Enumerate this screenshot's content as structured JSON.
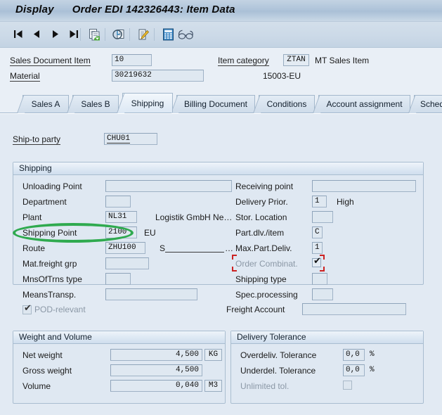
{
  "window": {
    "title_action": "Display",
    "title_object": "Order EDI 142326443: Item Data"
  },
  "toolbar": {
    "buttons": [
      {
        "name": "first-record-button",
        "icon": "first-record-icon",
        "glyph": "◀|",
        "label": "First record"
      },
      {
        "name": "previous-record-button",
        "icon": "previous-record-icon",
        "glyph": "◀",
        "label": "Previous record"
      },
      {
        "name": "next-record-button",
        "icon": "next-record-icon",
        "glyph": "▶",
        "label": "Next record"
      },
      {
        "name": "last-record-button",
        "icon": "last-record-icon",
        "glyph": "|▶",
        "label": "Last record"
      },
      {
        "name": "copy-items-button",
        "icon": "copy-documents-icon",
        "glyph": "",
        "label": "Copy items"
      },
      {
        "name": "document-flow-button",
        "icon": "document-flow-icon",
        "glyph": "",
        "label": "Document flow"
      },
      {
        "name": "display-doc-header-button",
        "icon": "display-header-details-icon",
        "glyph": "",
        "label": "Display document header details"
      },
      {
        "name": "availability-button",
        "icon": "calculator-icon",
        "glyph": "",
        "label": "Availability"
      },
      {
        "name": "display-range-button",
        "icon": "glasses-icon",
        "glyph": "",
        "label": "Display range"
      }
    ]
  },
  "header": {
    "sales_document_item_label": "Sales Document Item",
    "sales_document_item_value": "10",
    "material_label": "Material",
    "material_value": "30219632",
    "item_category_label": "Item category",
    "item_category_value": "ZTAN",
    "item_category_text": "MT Sales Item",
    "material_description": "15003-EU"
  },
  "tabs": [
    {
      "label": "Sales A",
      "active": false
    },
    {
      "label": "Sales B",
      "active": false
    },
    {
      "label": "Shipping",
      "active": true
    },
    {
      "label": "Billing Document",
      "active": false
    },
    {
      "label": "Conditions",
      "active": false
    },
    {
      "label": "Account assignment",
      "active": false
    },
    {
      "label": "Sched",
      "active": false
    }
  ],
  "ship_to": {
    "label": "Ship-to party",
    "value": "CHU01"
  },
  "shipping_group": {
    "title": "Shipping",
    "left": [
      {
        "label": "Unloading Point",
        "value": "",
        "width": "wide"
      },
      {
        "label": "Department",
        "value": "",
        "width": "narrow"
      },
      {
        "label": "Plant",
        "value": "NL31",
        "width": "small",
        "suffix": "Logistik GmbH Ne…"
      },
      {
        "label": "Shipping Point",
        "value": "2100",
        "width": "small",
        "suffix": "EU"
      },
      {
        "label": "Route",
        "value": "ZHU100",
        "width": "small",
        "suffix": "S"
      },
      {
        "label": "Mat.freight grp",
        "value": "",
        "width": "med"
      },
      {
        "label": "MnsOfTrns type",
        "value": "",
        "width": "narrow"
      },
      {
        "label": "MeansTransp.",
        "value": "",
        "width": "wide2"
      }
    ],
    "pod_relevant": {
      "label": "POD-relevant",
      "checked": true,
      "disabled": true
    },
    "right": [
      {
        "label": "Receiving point",
        "value": "",
        "width": "wide"
      },
      {
        "label": "Delivery Prior.",
        "value": "1",
        "width": "tiny",
        "suffix": "High"
      },
      {
        "label": "Stor. Location",
        "value": "",
        "width": "tiny2"
      },
      {
        "label": "Part.dlv./item",
        "value": "C",
        "width": "xtiny"
      },
      {
        "label": "Max.Part.Deliv.",
        "value": "1",
        "width": "xtiny"
      }
    ],
    "order_combination": {
      "label": "Order Combinat.",
      "checked": true,
      "disabled": true,
      "focused": true
    },
    "right2": [
      {
        "label": "Shipping type",
        "value": "",
        "width": "xtiny"
      },
      {
        "label": "Spec.processing",
        "value": "",
        "width": "tiny2"
      }
    ],
    "freight_account": {
      "label": "Freight Account",
      "value": ""
    }
  },
  "weight_volume_group": {
    "title": "Weight and Volume",
    "rows": [
      {
        "label": "Net weight",
        "value": "4,500",
        "unit": "KG"
      },
      {
        "label": "Gross weight",
        "value": "4,500",
        "unit": ""
      },
      {
        "label": "Volume",
        "value": "0,040",
        "unit": "M3"
      }
    ]
  },
  "delivery_tolerance_group": {
    "title": "Delivery Tolerance",
    "rows": [
      {
        "label": "Overdeliv. Tolerance",
        "value": "0,0",
        "unit": "%"
      },
      {
        "label": "Underdel. Tolerance",
        "value": "0,0",
        "unit": "%"
      }
    ],
    "unlimited": {
      "label": "Unlimited tol.",
      "checked": false,
      "disabled": true
    }
  },
  "annotations": {
    "highlight_color": "#2faa4f",
    "focus_color": "#cc2222",
    "highlight_target": "Shipping Point 2100"
  }
}
